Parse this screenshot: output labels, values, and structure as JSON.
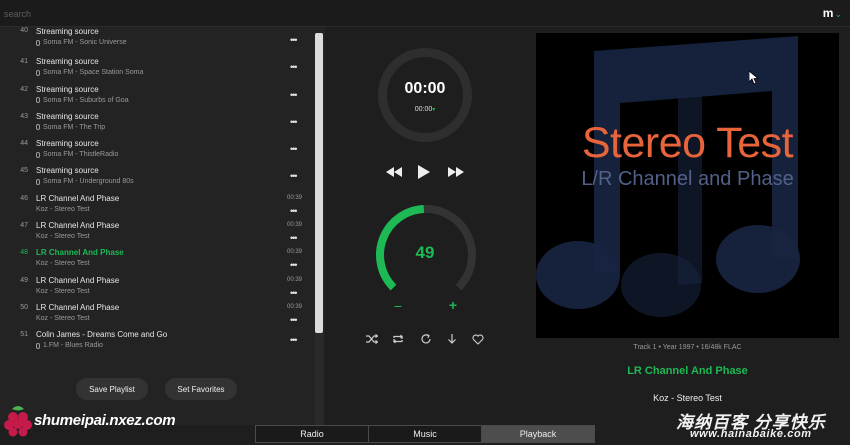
{
  "search": {
    "placeholder": "search"
  },
  "menu": {
    "logo": "m",
    "chevron": "⌄"
  },
  "playlist": {
    "rows": [
      {
        "num": "40",
        "title": "Streaming source",
        "sub": "Soma FM - Sonic Universe",
        "mic": true,
        "duration": "",
        "active": false
      },
      {
        "num": "41",
        "title": "Streaming source",
        "sub": "Soma FM - Space Station Soma",
        "mic": true,
        "duration": "",
        "active": false
      },
      {
        "num": "42",
        "title": "Streaming source",
        "sub": "Soma FM - Suburbs of Goa",
        "mic": true,
        "duration": "",
        "active": false
      },
      {
        "num": "43",
        "title": "Streaming source",
        "sub": "Soma FM - The Trip",
        "mic": true,
        "duration": "",
        "active": false
      },
      {
        "num": "44",
        "title": "Streaming source",
        "sub": "Soma FM - ThistleRadio",
        "mic": true,
        "duration": "",
        "active": false
      },
      {
        "num": "45",
        "title": "Streaming source",
        "sub": "Soma FM - Underground 80s",
        "mic": true,
        "duration": "",
        "active": false
      },
      {
        "num": "46",
        "title": "LR Channel And Phase",
        "sub": "Koz - Stereo Test",
        "mic": false,
        "duration": "00:39",
        "active": false
      },
      {
        "num": "47",
        "title": "LR Channel And Phase",
        "sub": "Koz - Stereo Test",
        "mic": false,
        "duration": "00:39",
        "active": false
      },
      {
        "num": "48",
        "title": "LR Channel And Phase",
        "sub": "Koz - Stereo Test",
        "mic": false,
        "duration": "00:39",
        "active": true
      },
      {
        "num": "49",
        "title": "LR Channel And Phase",
        "sub": "Koz - Stereo Test",
        "mic": false,
        "duration": "00:39",
        "active": false
      },
      {
        "num": "50",
        "title": "LR Channel And Phase",
        "sub": "Koz - Stereo Test",
        "mic": false,
        "duration": "00:39",
        "active": false
      },
      {
        "num": "51",
        "title": "Colin James - Dreams Come and Go",
        "sub": "1.FM - Blues Radio",
        "mic": true,
        "duration": "",
        "active": false
      }
    ],
    "more_glyph": "•••",
    "save_label": "Save Playlist",
    "favorites_label": "Set Favorites"
  },
  "player": {
    "time_main": "00:00",
    "time_sub": "00:00",
    "time_caret": "▾",
    "volume": "49",
    "volume_fraction": 0.49,
    "volume_minus": "−",
    "volume_plus": "+"
  },
  "album_art": {
    "title": "Stereo Test",
    "subtitle": "L/R Channel and Phase"
  },
  "now_playing": {
    "meta": "Track 1 • Year 1997 • 16/48k FLAC",
    "title": "LR Channel And Phase",
    "artist": "Koz - Stereo Test"
  },
  "tabs": [
    {
      "label": "Radio",
      "active": false
    },
    {
      "label": "Music",
      "active": false
    },
    {
      "label": "Playback",
      "active": true
    }
  ],
  "watermarks": {
    "logo": "shumeipai.nxez.com",
    "cn": "海纳百客 分享快乐",
    "url": "www.hainabaike.com"
  },
  "colors": {
    "accent": "#1db954",
    "background": "#1e1e1e",
    "art_title": "#e8643a",
    "art_sub": "#52608a"
  }
}
